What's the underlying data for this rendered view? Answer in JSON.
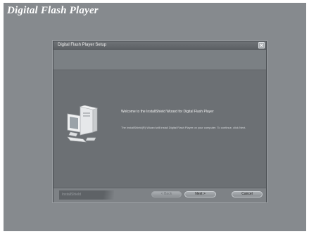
{
  "app": {
    "banner_title": "Digital Flash Player"
  },
  "dialog": {
    "title": "Digital Flash Player Setup",
    "welcome_title": "Welcome to the InstallShield Wizard for Digital Flash Player",
    "welcome_body": "The InstallShield(R) Wizard will install Digital Flash Player on your computer.  To continue, click Next.",
    "brand": "InstallShield",
    "buttons": {
      "back": "< Back",
      "next": "Next >",
      "cancel": "Cancel"
    }
  },
  "icons": {
    "close": "close-icon",
    "computer": "computer-icon"
  }
}
